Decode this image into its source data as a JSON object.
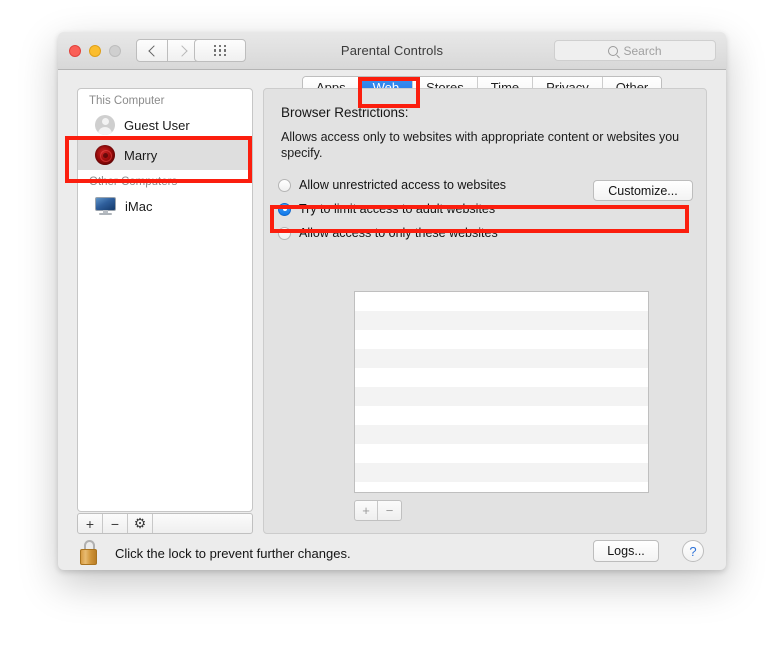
{
  "window": {
    "title": "Parental Controls",
    "traffic_lights": [
      "close",
      "minimize",
      "zoom"
    ],
    "nav": {
      "back": "back-arrow",
      "forward": "forward-arrow"
    },
    "show_all_label": "show-all-grid",
    "search": {
      "placeholder": "Search",
      "value": "",
      "icon": "search-icon"
    }
  },
  "tabs": [
    {
      "label": "Apps",
      "active": false
    },
    {
      "label": "Web",
      "active": true
    },
    {
      "label": "Stores",
      "active": false
    },
    {
      "label": "Time",
      "active": false
    },
    {
      "label": "Privacy",
      "active": false
    },
    {
      "label": "Other",
      "active": false
    }
  ],
  "sidebar": {
    "groups": [
      {
        "header": "This Computer",
        "users": [
          {
            "name": "Guest User",
            "avatar": "guest-silhouette-avatar",
            "selected": false
          },
          {
            "name": "Marry",
            "avatar": "red-rose-avatar",
            "selected": true
          }
        ]
      },
      {
        "header": "Other Computers",
        "users": [
          {
            "name": "iMac",
            "avatar": "imac-computer-icon",
            "selected": false
          }
        ]
      }
    ],
    "footer": {
      "add": "+",
      "remove": "−",
      "gear": "⚙"
    }
  },
  "panel": {
    "title": "Browser Restrictions:",
    "description": "Allows access only to websites with appropriate content or websites you specify.",
    "options": [
      {
        "label": "Allow unrestricted access to websites",
        "selected": false
      },
      {
        "label": "Try to limit access to adult websites",
        "selected": true
      },
      {
        "label": "Allow access to only these websites",
        "selected": false
      }
    ],
    "customize_label": "Customize...",
    "website_list": {
      "rows": [],
      "row_count": 11
    },
    "list_footer": {
      "add": "+",
      "remove": "−"
    }
  },
  "bottom": {
    "lock_icon": "unlocked-padlock",
    "lock_text": "Click the lock to prevent further changes.",
    "logs_label": "Logs...",
    "help_label": "?"
  },
  "annotations": {
    "color": "#fb1e0e",
    "boxes": [
      "web-tab-highlight",
      "marry-user-highlight",
      "adult-websites-option-highlight"
    ]
  }
}
